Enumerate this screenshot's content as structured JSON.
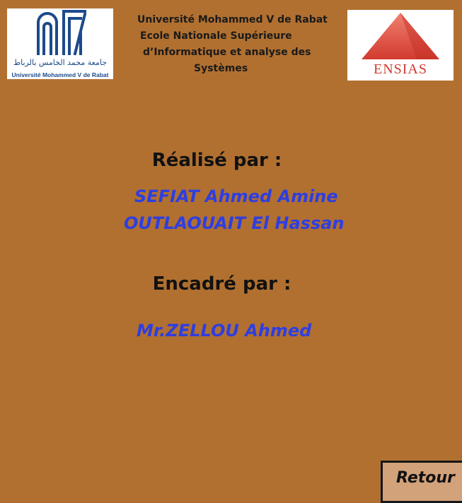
{
  "logos": {
    "left": {
      "caption": "Université Mohammed V de Rabat",
      "arabic_text": "جامعة محمد الخامس بالرباط",
      "icon": "university-emblem-icon"
    },
    "right": {
      "caption": "ENSIAS",
      "icon": "red-pyramid-icon"
    }
  },
  "header": {
    "line1": "Université Mohammed V de Rabat",
    "line2": "Ecole Nationale Supérieure",
    "line3": "d’Informatique et analyse des",
    "line4": "Systèmes"
  },
  "realise": {
    "title": "Réalisé par :",
    "members": [
      "SEFIAT Ahmed Amine",
      "OUTLAOUAIT El Hassan"
    ]
  },
  "encadre": {
    "title": "Encadré par :",
    "supervisor": "Mr.ZELLOU Ahmed"
  },
  "buttons": {
    "back_label": "Retour"
  },
  "colors": {
    "background": "#b17030",
    "names": "#2e3ee0",
    "ensias_red": "#d23a2f",
    "um5_blue": "#1c4a8a",
    "button": "#d2a27a"
  }
}
